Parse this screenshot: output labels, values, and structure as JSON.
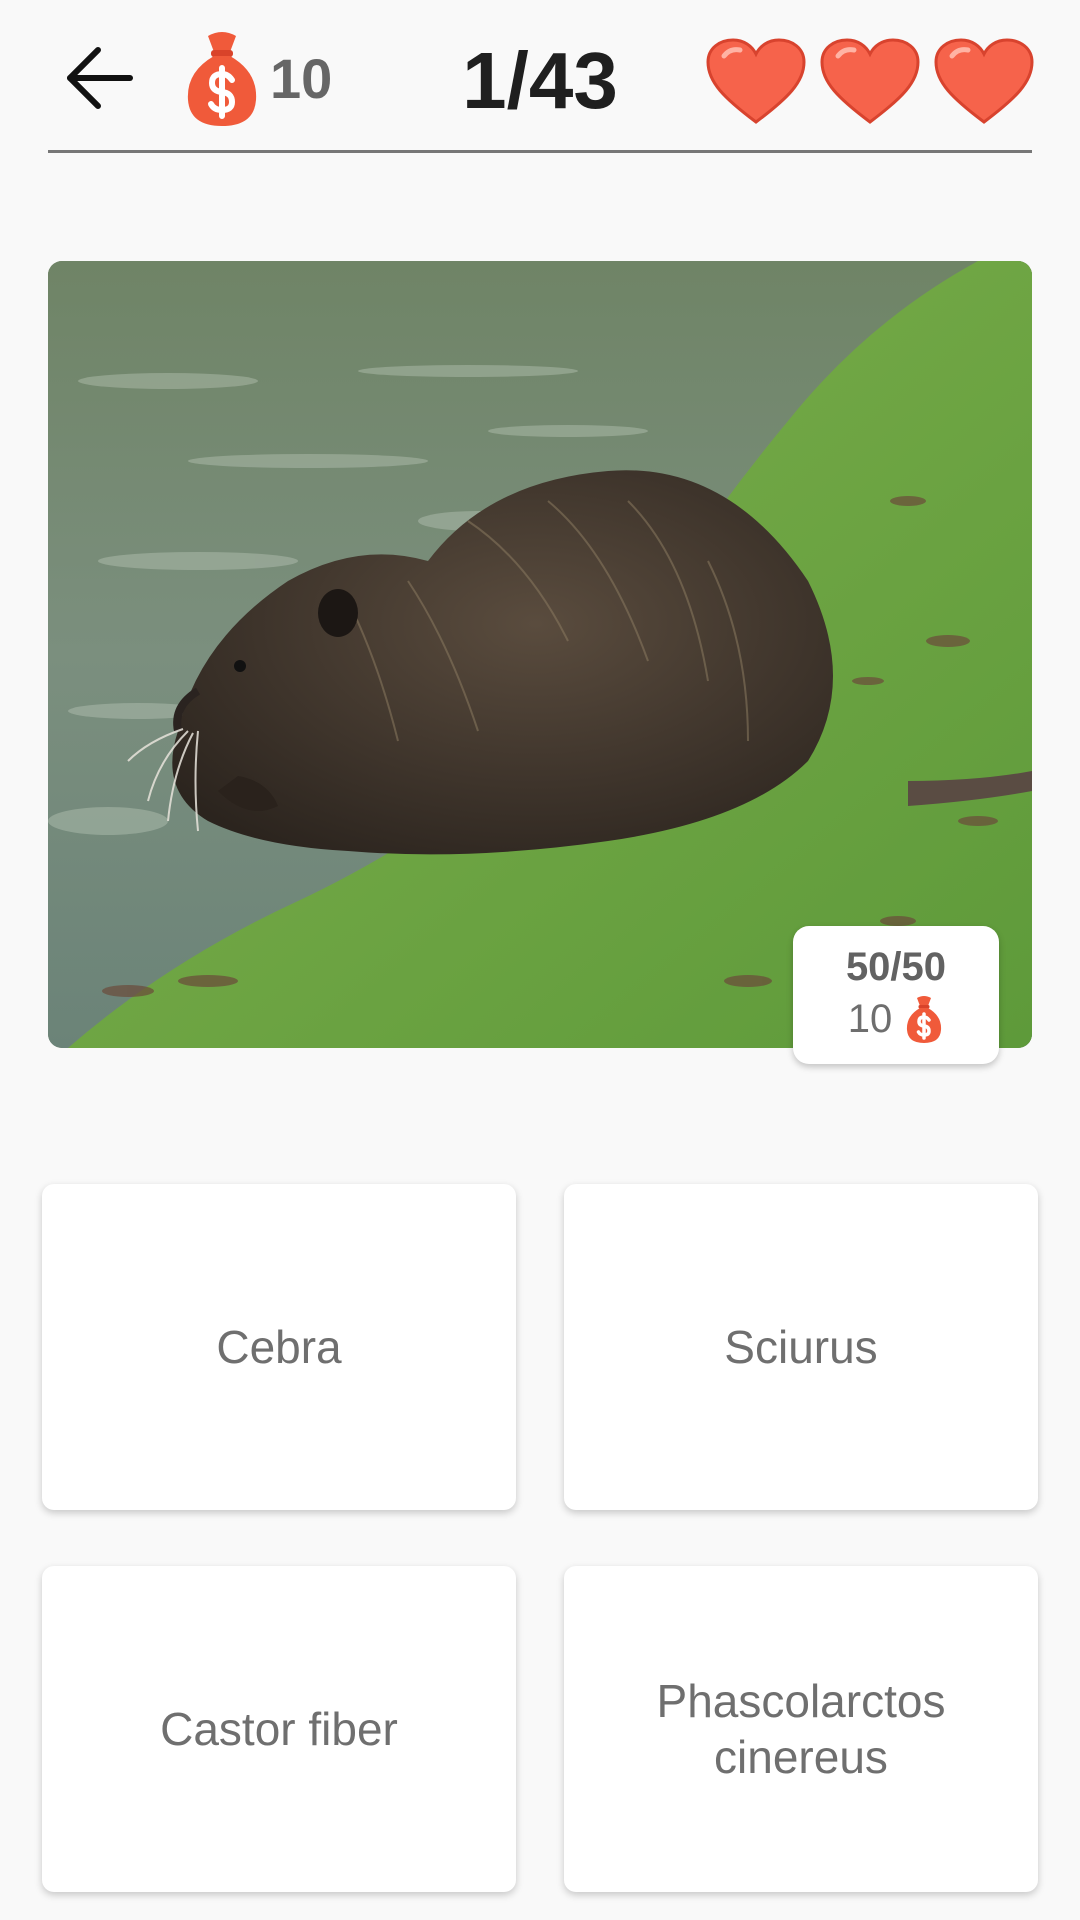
{
  "header": {
    "coins": "10",
    "progress": "1/43",
    "lives": 3,
    "icons": {
      "back": "arrow-left-icon",
      "coins": "money-bag-icon",
      "lives": "heart-icon"
    }
  },
  "question": {
    "image_subject": "nutria",
    "badge": {
      "score": "50/50",
      "reward": "10"
    }
  },
  "answers": [
    {
      "label": "Cebra"
    },
    {
      "label": "Sciurus"
    },
    {
      "label": "Castor fiber"
    },
    {
      "label": "Phascolarctos\ncinereus"
    }
  ],
  "colors": {
    "heart": "#f6634b",
    "bag": "#f05a3a",
    "background": "#f9f9f9"
  }
}
